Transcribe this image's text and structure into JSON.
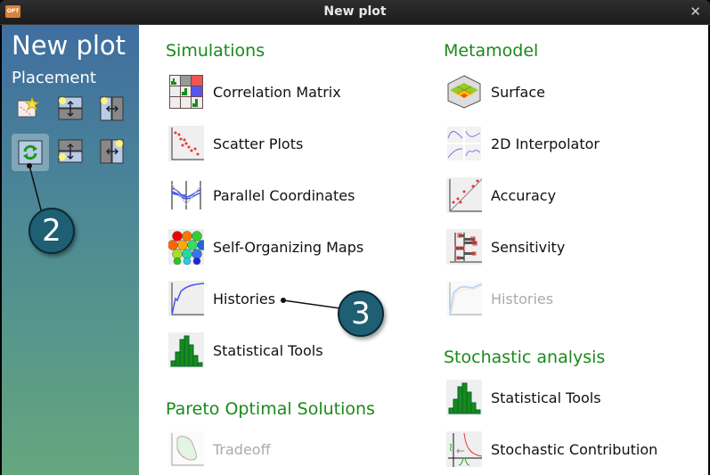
{
  "window": {
    "title": "New plot",
    "app_icon_label": "OPT"
  },
  "sidebar": {
    "title": "New plot",
    "subtitle": "Placement"
  },
  "callouts": [
    "2",
    "3"
  ],
  "columns": [
    {
      "sections": [
        {
          "title": "Simulations",
          "items": [
            {
              "label": "Correlation Matrix",
              "icon": "correlation-matrix-icon",
              "enabled": true
            },
            {
              "label": "Scatter Plots",
              "icon": "scatter-plot-icon",
              "enabled": true
            },
            {
              "label": "Parallel Coordinates",
              "icon": "parallel-coordinates-icon",
              "enabled": true
            },
            {
              "label": "Self-Organizing Maps",
              "icon": "som-icon",
              "enabled": true
            },
            {
              "label": "Histories",
              "icon": "histories-icon",
              "enabled": true
            },
            {
              "label": "Statistical Tools",
              "icon": "histogram-icon",
              "enabled": true
            }
          ]
        },
        {
          "title": "Pareto Optimal Solutions",
          "items": [
            {
              "label": "Tradeoff",
              "icon": "tradeoff-icon",
              "enabled": false
            }
          ]
        }
      ]
    },
    {
      "sections": [
        {
          "title": "Metamodel",
          "items": [
            {
              "label": "Surface",
              "icon": "surface-icon",
              "enabled": true
            },
            {
              "label": "2D Interpolator",
              "icon": "interpolator-icon",
              "enabled": true
            },
            {
              "label": "Accuracy",
              "icon": "accuracy-icon",
              "enabled": true
            },
            {
              "label": "Sensitivity",
              "icon": "sensitivity-icon",
              "enabled": true
            },
            {
              "label": "Histories",
              "icon": "histories-icon",
              "enabled": false
            }
          ]
        },
        {
          "title": "Stochastic analysis",
          "items": [
            {
              "label": "Statistical Tools",
              "icon": "histogram-icon",
              "enabled": true
            },
            {
              "label": "Stochastic Contribution",
              "icon": "stochastic-contribution-icon",
              "enabled": true
            }
          ]
        }
      ]
    }
  ]
}
